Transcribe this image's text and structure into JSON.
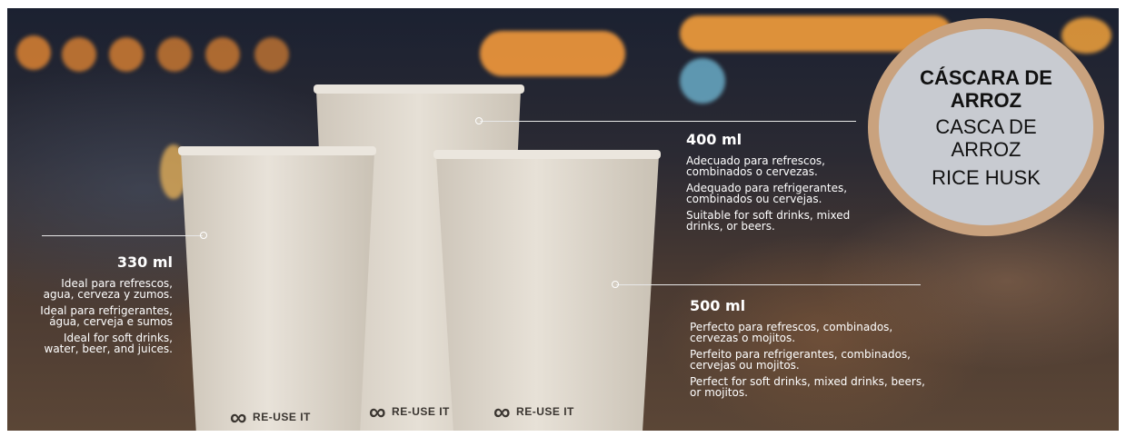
{
  "badge": {
    "es": "CÁSCARA DE ARROZ",
    "pt": "CASCA DE ARROZ",
    "en": "RICE HUSK"
  },
  "brand": {
    "logo_text": "RE-USE IT",
    "logo_icon": "infinity-icon"
  },
  "cups": {
    "cup330": {
      "size": "330 ml",
      "es": "Ideal para refrescos, agua, cerveza y zumos.",
      "pt": "Ideal para refrigerantes, água, cerveja e sumos",
      "en": "Ideal for soft drinks, water, beer, and juices."
    },
    "cup400": {
      "size": "400 ml",
      "es": "Adecuado para refrescos, combinados o cervezas.",
      "pt": "Adequado para refrigerantes, combinados ou cervejas.",
      "en": "Suitable for soft drinks, mixed drinks, or beers."
    },
    "cup500": {
      "size": "500 ml",
      "es": "Perfecto para refrescos, combinados, cervezas o mojitos.",
      "pt": "Perfeito para refrigerantes, combinados, cervejas ou mojitos.",
      "en": "Perfect for soft drinks, mixed drinks, beers, or mojitos."
    }
  },
  "colors": {
    "badge_ring": "#c9a27e",
    "badge_fill": "#c8cbd1",
    "cup": "#e4ddd2",
    "text": "#ffffff"
  }
}
